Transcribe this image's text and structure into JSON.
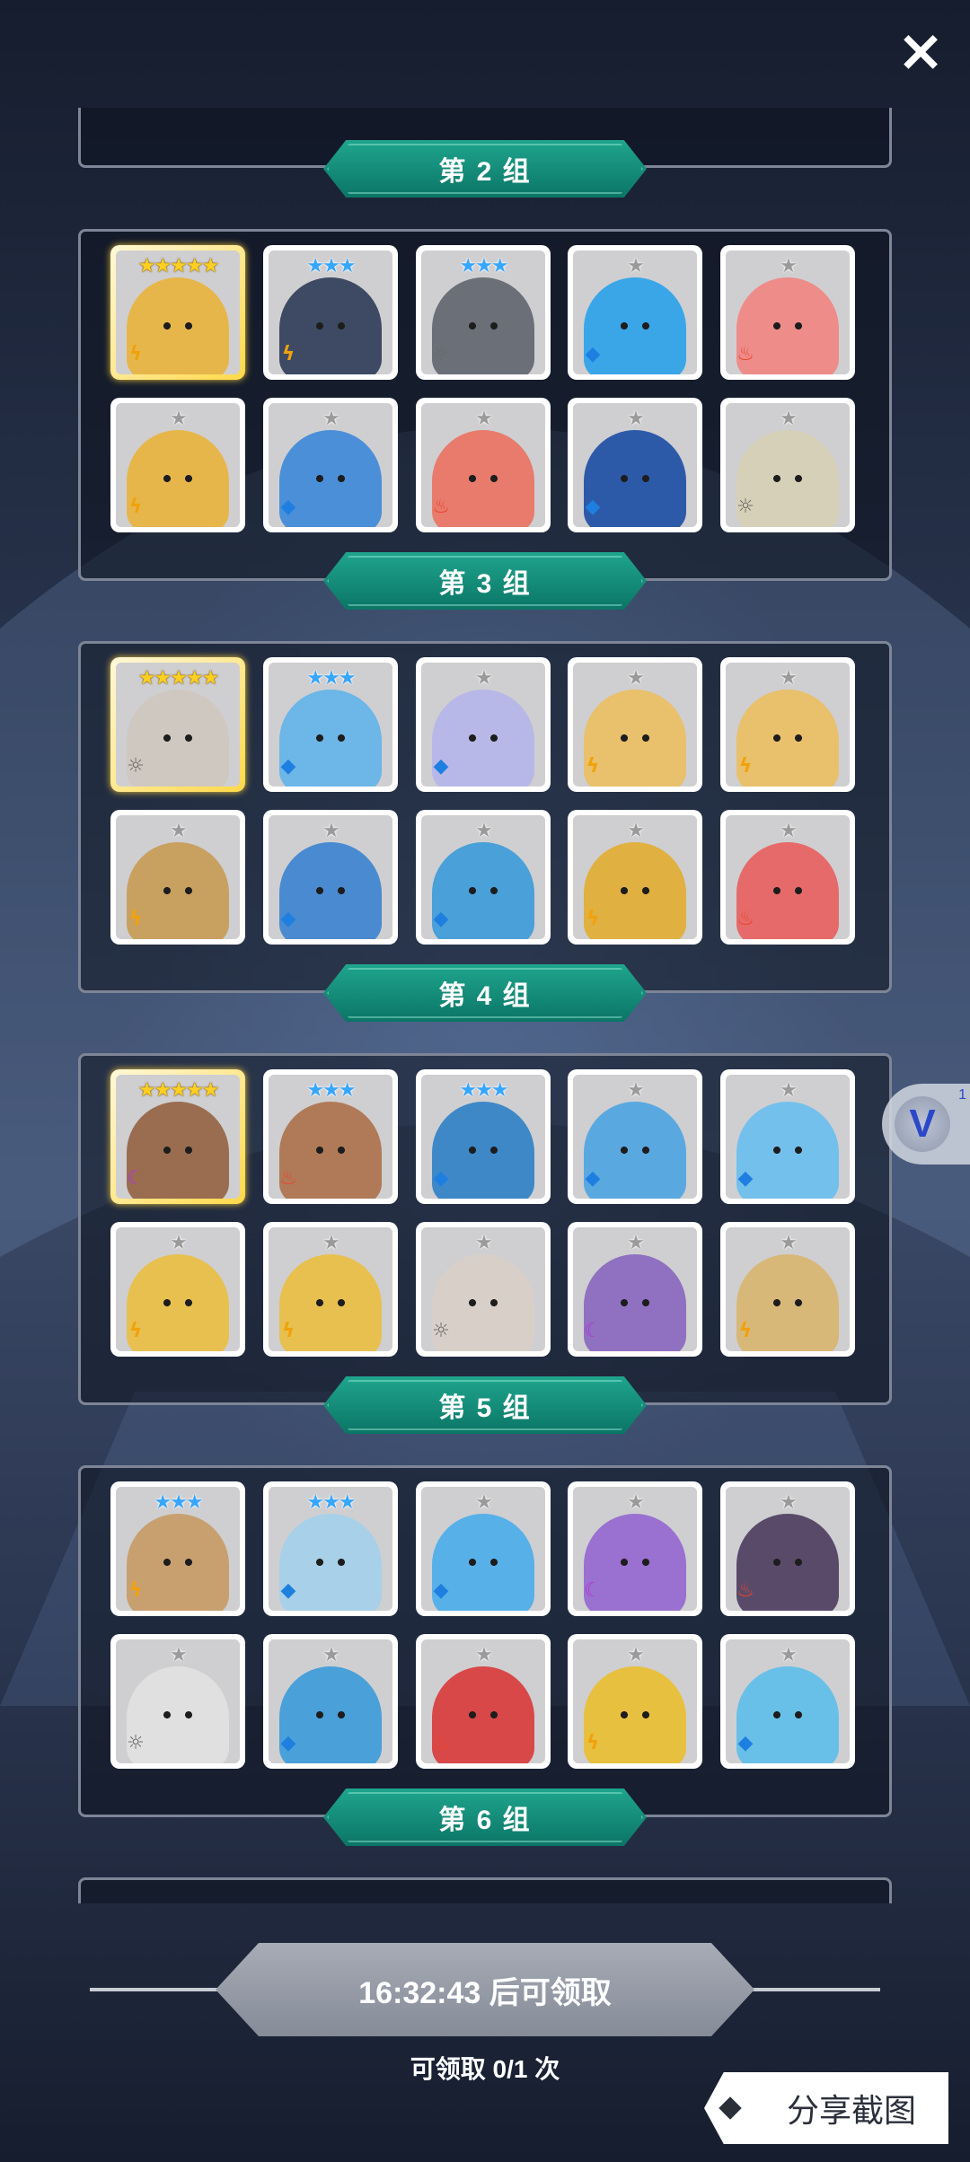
{
  "close_icon": "×",
  "groups": [
    {
      "label": "第 2 组",
      "cards": [
        {
          "stars": 5,
          "element": "light",
          "color": "#e7b64b",
          "gold": true
        },
        {
          "stars": 3,
          "element": "light",
          "color": "#3e4a63"
        },
        {
          "stars": 3,
          "element": "sun",
          "color": "#6b6f78"
        },
        {
          "stars": 1,
          "element": "water",
          "color": "#3aa6e8"
        },
        {
          "stars": 1,
          "element": "fire",
          "color": "#ee8c8a"
        },
        {
          "stars": 1,
          "element": "light",
          "color": "#e7b64b"
        },
        {
          "stars": 1,
          "element": "water",
          "color": "#4b8fd8"
        },
        {
          "stars": 1,
          "element": "fire",
          "color": "#e87b6c"
        },
        {
          "stars": 1,
          "element": "water",
          "color": "#2d5aa8"
        },
        {
          "stars": 1,
          "element": "sun",
          "color": "#d7d0b8"
        }
      ]
    },
    {
      "label": "第 3 组",
      "cards": [
        {
          "stars": 5,
          "element": "sun",
          "color": "#cfc8c0",
          "gold": true
        },
        {
          "stars": 3,
          "element": "water",
          "color": "#6cb6e8"
        },
        {
          "stars": 1,
          "element": "water",
          "color": "#b8b8e8"
        },
        {
          "stars": 1,
          "element": "light",
          "color": "#e9c06b"
        },
        {
          "stars": 1,
          "element": "light",
          "color": "#e9c06b"
        },
        {
          "stars": 1,
          "element": "light",
          "color": "#c8a060"
        },
        {
          "stars": 1,
          "element": "water",
          "color": "#4a8ad0"
        },
        {
          "stars": 1,
          "element": "water",
          "color": "#4aa0d8"
        },
        {
          "stars": 1,
          "element": "light",
          "color": "#e0b040"
        },
        {
          "stars": 1,
          "element": "fire",
          "color": "#e66a6a"
        }
      ]
    },
    {
      "label": "第 4 组",
      "cards": [
        {
          "stars": 5,
          "element": "dark",
          "color": "#9a6c50",
          "gold": true
        },
        {
          "stars": 3,
          "element": "fire",
          "color": "#b07a58"
        },
        {
          "stars": 3,
          "element": "water",
          "color": "#3e88c8"
        },
        {
          "stars": 1,
          "element": "water",
          "color": "#5aa8e0"
        },
        {
          "stars": 1,
          "element": "water",
          "color": "#74c0ec"
        },
        {
          "stars": 1,
          "element": "light",
          "color": "#e8c050"
        },
        {
          "stars": 1,
          "element": "light",
          "color": "#e8c050"
        },
        {
          "stars": 1,
          "element": "sun",
          "color": "#d8d0c8"
        },
        {
          "stars": 1,
          "element": "dark",
          "color": "#9070c0"
        },
        {
          "stars": 1,
          "element": "light",
          "color": "#d8b878"
        }
      ]
    },
    {
      "label": "第 5 组",
      "cards": [
        {
          "stars": 3,
          "element": "light",
          "color": "#c8a070"
        },
        {
          "stars": 3,
          "element": "water",
          "color": "#a8d0e8"
        },
        {
          "stars": 1,
          "element": "water",
          "color": "#58b0e8"
        },
        {
          "stars": 1,
          "element": "dark",
          "color": "#9a70d0"
        },
        {
          "stars": 1,
          "element": "fire",
          "color": "#5a4a6a"
        },
        {
          "stars": 1,
          "element": "sun",
          "color": "#e0e0e0"
        },
        {
          "stars": 1,
          "element": "water",
          "color": "#4aa0d8"
        },
        {
          "stars": 1,
          "element": "fire",
          "color": "#d84848"
        },
        {
          "stars": 1,
          "element": "light",
          "color": "#e8c040"
        },
        {
          "stars": 1,
          "element": "water",
          "color": "#68c0e8"
        }
      ]
    },
    {
      "label": "第 6 组",
      "cards": []
    }
  ],
  "float_button": {
    "icon": "V",
    "badge": "1"
  },
  "footer": {
    "timer_label": "16:32:43 后可领取",
    "claim_count": "可领取 0/1 次",
    "share_label": "分享截图"
  }
}
